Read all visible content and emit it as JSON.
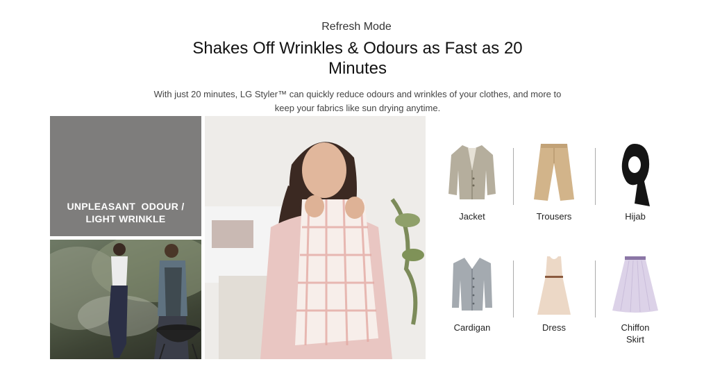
{
  "section": {
    "eyebrow": "Refresh Mode",
    "headline": "Shakes Off Wrinkles & Odours as Fast as 20 Minutes",
    "description": "With just 20 minutes, LG Styler™ can quickly reduce odours and wrinkles of your clothes, and more to keep your fabrics like sun drying anytime."
  },
  "odour_box": {
    "label_line1": "UNPLEASANT  ODOUR /",
    "label_line2": "LIGHT WRINKLE",
    "icon": "odour-waves-icon"
  },
  "garments": [
    {
      "label": "Jacket",
      "icon": "jacket-icon"
    },
    {
      "label": "Trousers",
      "icon": "trousers-icon"
    },
    {
      "label": "Hijab",
      "icon": "hijab-icon"
    },
    {
      "label": "Cardigan",
      "icon": "cardigan-icon"
    },
    {
      "label": "Dress",
      "icon": "dress-icon"
    },
    {
      "label_line1": "Chiffon",
      "label_line2": "Skirt",
      "icon": "chiffon-skirt-icon"
    }
  ],
  "colors": {
    "odour_box_bg": "#7e7d7c",
    "text_primary": "#111111",
    "divider": "#aaaaaa"
  }
}
